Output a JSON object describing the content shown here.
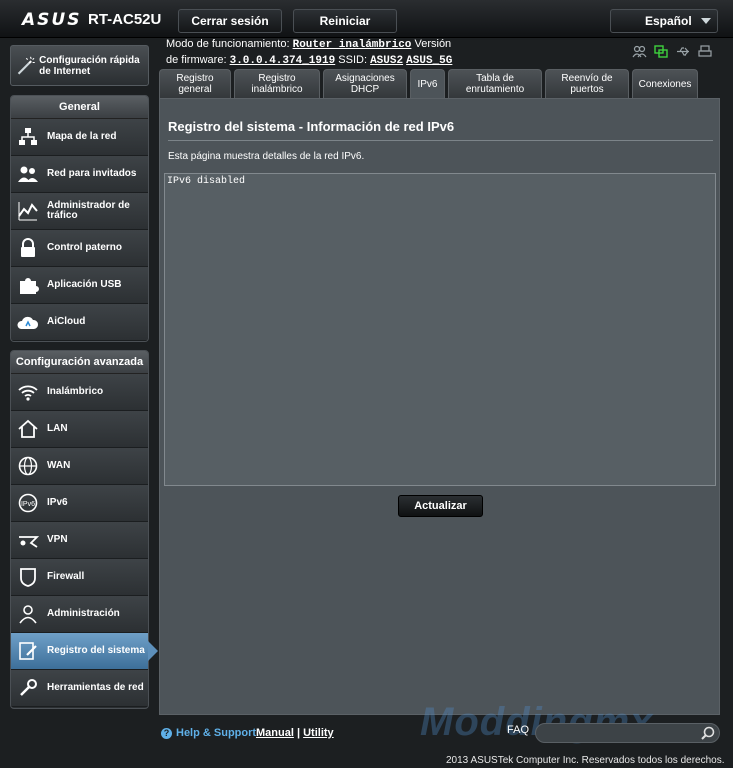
{
  "header": {
    "brand": "ASUS",
    "model": "RT-AC52U",
    "logout_label": "Cerrar sesión",
    "reboot_label": "Reiniciar",
    "language": "Español"
  },
  "info": {
    "mode_label": "Modo de funcionamiento:",
    "mode_value": "Router inalámbrico",
    "firmware_label": "Versión de firmware:",
    "firmware_value": "3.0.0.4.374_1919",
    "ssid_label": "SSID:",
    "ssid_24": "ASUS2",
    "ssid_5": "ASUS_5G"
  },
  "quick_setup": {
    "label": "Configuración rápida de Internet"
  },
  "general": {
    "title": "General",
    "items": [
      {
        "label": "Mapa de la red",
        "icon": "network-map-icon"
      },
      {
        "label": "Red para invitados",
        "icon": "guest-network-icon"
      },
      {
        "label": "Administrador de tráfico",
        "icon": "traffic-manager-icon"
      },
      {
        "label": "Control paterno",
        "icon": "parental-control-icon"
      },
      {
        "label": "Aplicación USB",
        "icon": "usb-app-icon"
      },
      {
        "label": "AiCloud",
        "icon": "aicloud-icon"
      }
    ]
  },
  "advanced": {
    "title": "Configuración avanzada",
    "items": [
      {
        "label": "Inalámbrico",
        "icon": "wireless-icon"
      },
      {
        "label": "LAN",
        "icon": "lan-icon"
      },
      {
        "label": "WAN",
        "icon": "wan-icon"
      },
      {
        "label": "IPv6",
        "icon": "ipv6-icon"
      },
      {
        "label": "VPN",
        "icon": "vpn-icon"
      },
      {
        "label": "Firewall",
        "icon": "firewall-icon"
      },
      {
        "label": "Administración",
        "icon": "administration-icon"
      },
      {
        "label": "Registro del sistema",
        "icon": "system-log-icon"
      },
      {
        "label": "Herramientas de red",
        "icon": "network-tools-icon"
      }
    ]
  },
  "tabs": [
    {
      "label": "Registro general"
    },
    {
      "label": "Registro inalámbrico"
    },
    {
      "label": "Asignaciones DHCP"
    },
    {
      "label": "IPv6"
    },
    {
      "label": "Tabla de enrutamiento"
    },
    {
      "label": "Reenvío de puertos"
    },
    {
      "label": "Conexiones"
    }
  ],
  "main": {
    "title": "Registro del sistema - Información de red IPv6",
    "description": "Esta página muestra detalles de la red IPv6.",
    "log_text": "IPv6 disabled",
    "refresh_label": "Actualizar"
  },
  "footer": {
    "help_label": "Help & Support",
    "manual_label": "Manual",
    "separator": "|",
    "utility_label": "Utility",
    "faq_label": "FAQ",
    "copyright": "2013 ASUSTek Computer Inc. Reservados todos los derechos.",
    "watermark": "Moddingmx"
  },
  "colors": {
    "accent": "#5d8fba",
    "panel": "#4d5459",
    "help": "#5fb0e8"
  }
}
